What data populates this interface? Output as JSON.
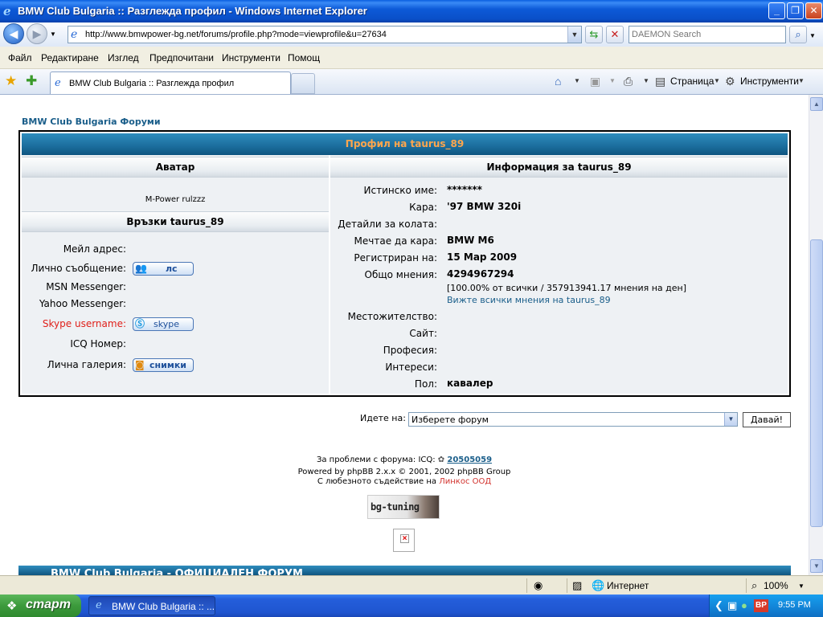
{
  "window": {
    "title": "BMW Club Bulgaria :: Разглежда профил - Windows Internet Explorer",
    "minimize_glyph": "_",
    "maximize_glyph": "❐",
    "close_glyph": "✕"
  },
  "navigation": {
    "url": "http://www.bmwpower-bg.net/forums/profile.php?mode=viewprofile&u=27634",
    "search_placeholder": "DAEMON Search"
  },
  "menu": [
    "Файл",
    "Редактиране",
    "Изглед",
    "Предпочитани",
    "Инструменти",
    "Помощ"
  ],
  "tabs": {
    "active_label": "BMW Club Bulgaria :: Разглежда профил"
  },
  "commandbar": {
    "page_label": "Страница",
    "tools_label": "Инструменти"
  },
  "page": {
    "forum_link": "BMW Club Bulgaria Форуми",
    "profile_header": "Профил на taurus_89",
    "avatar_header": "Аватар",
    "info_header": "Информация за taurus_89",
    "avatar_text": "M-Power rulzzz",
    "contacts_header": "Връзки taurus_89",
    "contacts": {
      "email_label": "Мейл адрес:",
      "pm_label": "Лично съобщение:",
      "pm_button": "лс",
      "msn_label": "MSN Messenger:",
      "yahoo_label": "Yahoo Messenger:",
      "skype_label": "Skype username:",
      "skype_button": "skype",
      "icq_label": "ICQ Номер:",
      "gallery_label": "Лична галерия:",
      "gallery_button": "снимки"
    },
    "info": {
      "realname_label": "Истинско име:",
      "realname_value": "*******",
      "car_label": "Кара:",
      "car_value": "'97 BMW 320i",
      "car_details_label": "Детайли за колата:",
      "dream_label": "Мечтае да кара:",
      "dream_value": "BMW M6",
      "registered_label": "Регистриран на:",
      "registered_value": "15 Мар 2009",
      "posts_label": "Общо мнения:",
      "posts_value": "4294967294",
      "posts_stats": "[100.00% от всички / 357913941.17 мнения на ден]",
      "posts_link": "Вижте всички мнения на taurus_89",
      "location_label": "Местожителство:",
      "site_label": "Сайт:",
      "occupation_label": "Професия:",
      "interests_label": "Интереси:",
      "gender_label": "Пол:",
      "gender_value": "кавалер"
    },
    "jump": {
      "label": "Идете на:",
      "selected": "Изберете форум",
      "go_button": "Давай!"
    },
    "footer": {
      "problems_text": "За проблеми с форума:  ICQ:",
      "icq_number": "20505059",
      "powered_text": "Powered by phpBB 2.x.x © 2001, 2002 phpBB Group",
      "support_text": "С любезното съдействие на",
      "support_company": "Линкос ООД",
      "logo_text": "bg-tuning",
      "banner_text": "BMW Club Bulgaria - ОФИЦИАЛЕН ФОРУМ"
    }
  },
  "statusbar": {
    "zone": "Интернет",
    "zoom": "100%"
  },
  "taskbar": {
    "start_label": "старт",
    "task_label": "BMW Club Bulgaria :: ...",
    "lang": "BP",
    "clock": "9:55 PM"
  }
}
